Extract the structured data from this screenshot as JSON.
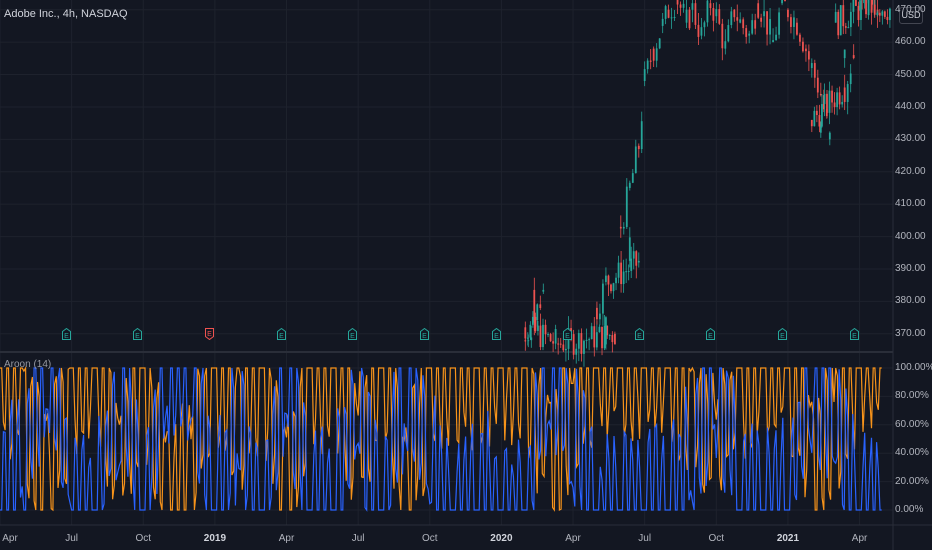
{
  "header": {
    "title": "Adobe Inc., 4h, NASDAQ",
    "currency": "USD"
  },
  "indicator": {
    "title": "Aroon (14)"
  },
  "colors": {
    "background": "#131722",
    "grid": "#1e222d",
    "candle_up": "#26a69a",
    "candle_down": "#ef5350",
    "aroon_up": "#f7931a",
    "aroon_down": "#2962ff",
    "earnings_normal": "#26a69a",
    "earnings_miss": "#ef5350",
    "divider": "#2a2e39"
  },
  "earnings_markers": {
    "icon": "earnings-e-icon",
    "label": "E",
    "items": [
      {
        "date": "2018-06",
        "result": "normal"
      },
      {
        "date": "2018-09",
        "result": "normal"
      },
      {
        "date": "2018-12",
        "result": "miss"
      },
      {
        "date": "2019-03",
        "result": "normal"
      },
      {
        "date": "2019-06",
        "result": "normal"
      },
      {
        "date": "2019-09",
        "result": "normal"
      },
      {
        "date": "2019-12",
        "result": "normal"
      },
      {
        "date": "2020-03",
        "result": "normal"
      },
      {
        "date": "2020-06",
        "result": "normal"
      },
      {
        "date": "2020-09",
        "result": "normal"
      },
      {
        "date": "2020-12",
        "result": "normal"
      },
      {
        "date": "2021-03",
        "result": "normal"
      }
    ]
  },
  "chart_data": [
    {
      "type": "candlestick",
      "title": "Adobe Inc., 4h, NASDAQ",
      "xlabel": "",
      "ylabel": "USD",
      "ylim": [
        365,
        473
      ],
      "y_ticks": [
        "470.00",
        "460.00",
        "450.00",
        "440.00",
        "430.00",
        "420.00",
        "410.00",
        "400.00",
        "390.00",
        "380.00",
        "370.00"
      ],
      "series": [
        {
          "x": [
            "2020-02",
            "2020-02",
            "2020-02",
            "2020-02",
            "2020-03",
            "2020-05",
            "2020-05",
            "2020-05",
            "2020-06",
            "2020-06",
            "2020-06",
            "2020-06",
            "2020-07",
            "2020-07",
            "2020-07",
            "2020-08",
            "2020-08",
            "2020-08",
            "2020-09",
            "2020-09",
            "2020-09",
            "2020-10",
            "2020-10",
            "2020-10",
            "2020-11",
            "2020-11",
            "2020-11",
            "2020-12",
            "2020-12",
            "2020-12",
            "2021-01",
            "2021-01",
            "2021-01",
            "2021-02",
            "2021-02",
            "2021-02",
            "2021-02",
            "2021-03",
            "2021-03",
            "2021-03",
            "2021-04",
            "2021-04",
            "2021-04",
            "2021-05"
          ],
          "close": [
            368,
            375,
            383,
            372,
            367,
            370,
            378,
            386,
            392,
            403,
            415,
            428,
            448,
            458,
            465,
            470,
            473,
            466,
            470,
            462,
            472,
            468,
            458,
            470,
            466,
            462,
            472,
            468,
            460,
            472,
            470,
            466,
            458,
            452,
            444,
            430,
            436,
            446,
            456,
            466,
            472,
            470,
            473,
            470
          ]
        }
      ]
    },
    {
      "type": "line",
      "title": "Aroon (14)",
      "xlabel": "",
      "ylabel": "",
      "ylim": [
        0,
        100
      ],
      "y_ticks": [
        "100.00%",
        "80.00%",
        "60.00%",
        "40.00%",
        "20.00%",
        "0.00%"
      ],
      "x_ticks": [
        "Apr",
        "Jul",
        "Oct",
        "2019",
        "Apr",
        "Jul",
        "Oct",
        "2020",
        "Apr",
        "Jul",
        "Oct",
        "2021",
        "Apr"
      ],
      "categories": [
        "2018-04",
        "2018-05",
        "2018-06",
        "2018-07",
        "2018-08",
        "2018-09",
        "2018-10",
        "2018-11",
        "2018-12",
        "2019-01",
        "2019-02",
        "2019-03",
        "2019-04",
        "2019-05",
        "2019-06",
        "2019-07",
        "2019-08",
        "2019-09",
        "2019-10",
        "2019-11",
        "2019-12",
        "2020-01",
        "2020-02",
        "2020-03",
        "2020-04",
        "2020-05",
        "2020-06",
        "2020-07",
        "2020-08",
        "2020-09",
        "2020-10",
        "2020-11",
        "2020-12",
        "2021-01",
        "2021-02",
        "2021-03",
        "2021-04",
        "2021-05"
      ],
      "series": [
        {
          "values": [
            100,
            71,
            14,
            86,
            100,
            36,
            93,
            7,
            29,
            100,
            57,
            100,
            21,
            86,
            100,
            43,
            100,
            14,
            79,
            100,
            93,
            100,
            100,
            29,
            64,
            100,
            100,
            100,
            100,
            71,
            43,
            86,
            100,
            93,
            36,
            57,
            100,
            100
          ]
        },
        {
          "values": [
            7,
            43,
            100,
            21,
            0,
            86,
            14,
            100,
            93,
            7,
            64,
            0,
            100,
            14,
            7,
            79,
            0,
            93,
            36,
            0,
            21,
            7,
            0,
            100,
            57,
            0,
            7,
            0,
            14,
            43,
            86,
            21,
            7,
            14,
            93,
            64,
            0,
            7
          ]
        }
      ]
    }
  ]
}
